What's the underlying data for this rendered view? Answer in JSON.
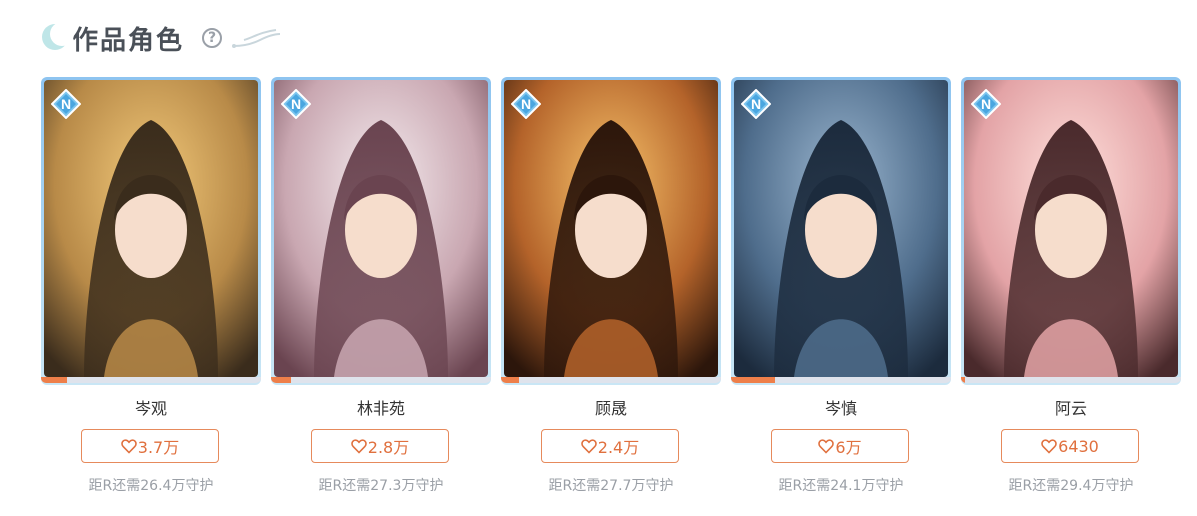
{
  "section": {
    "title": "作品角色",
    "help_icon": "question-circle-icon",
    "help_glyph": "?",
    "decor_icon": "swirl-icon"
  },
  "colors": {
    "accent": "#e0703e",
    "progress": "#ee7f4a",
    "frame": "#8ec4f0",
    "muted": "#9a9fa6"
  },
  "characters": [
    {
      "name": "岑观",
      "likes": "3.7万",
      "guard": "距R还需26.4万守护",
      "rank": "N",
      "progress": 0.12,
      "palette": [
        "#f2c97a",
        "#b88a48",
        "#3a2c1c"
      ]
    },
    {
      "name": "林非苑",
      "likes": "2.8万",
      "guard": "距R还需27.3万守护",
      "rank": "N",
      "progress": 0.09,
      "palette": [
        "#f4ebee",
        "#c9a7b1",
        "#6a4450"
      ]
    },
    {
      "name": "顾晟",
      "likes": "2.4万",
      "guard": "距R还需27.7万守护",
      "rank": "N",
      "progress": 0.08,
      "palette": [
        "#f7c36b",
        "#b4632a",
        "#2c160b"
      ]
    },
    {
      "name": "岑慎",
      "likes": "6万",
      "guard": "距R还需24.1万守护",
      "rank": "N",
      "progress": 0.2,
      "palette": [
        "#9bb6cf",
        "#4f6d8c",
        "#1c2b3d"
      ]
    },
    {
      "name": "阿云",
      "likes": "6430",
      "guard": "距R还需29.4万守护",
      "rank": "N",
      "progress": 0.02,
      "palette": [
        "#ffe1dc",
        "#e3a3a6",
        "#4a2a2c"
      ]
    }
  ]
}
